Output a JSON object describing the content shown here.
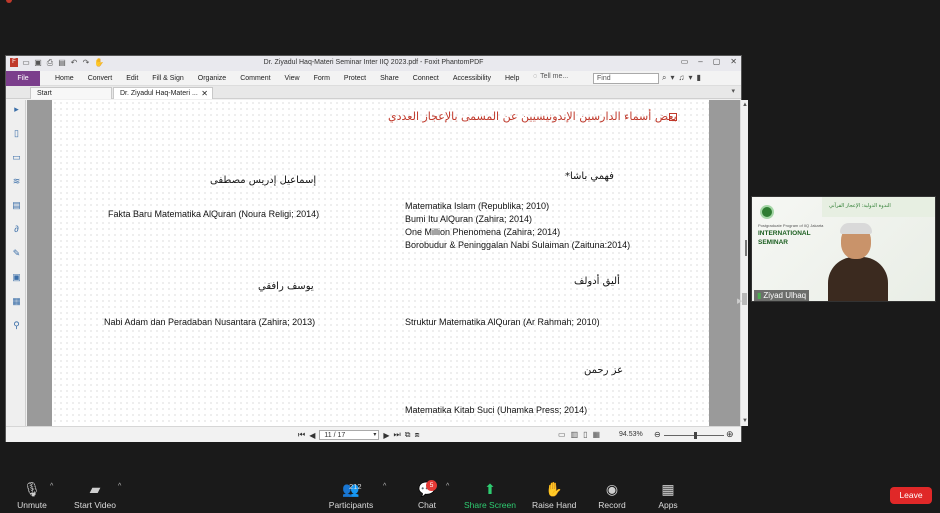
{
  "zoom_top": {
    "recording_label": ""
  },
  "foxit": {
    "window_title": "Dr. Ziyadul Haq-Materi Seminar Inter IIQ 2023.pdf - Foxit PhantomPDF",
    "menu": {
      "file": "File",
      "items": [
        "Home",
        "Convert",
        "Edit",
        "Fill & Sign",
        "Organize",
        "Comment",
        "View",
        "Form",
        "Protect",
        "Share",
        "Connect",
        "Accessibility",
        "Help"
      ],
      "tell_me": "Tell me...",
      "find_placeholder": "Find"
    },
    "tabs": [
      {
        "label": "Start"
      },
      {
        "label": "Dr. Ziyadul Haq-Materi ..."
      }
    ],
    "page": {
      "heading": "بعض أسماء الدارسين الإندونيسيين عن المسمى بالإعجاز العددي",
      "left": [
        {
          "name": "إسماعيل إدريس مصطفى",
          "works": [
            "Fakta Baru Matematika AlQuran (Noura Religi; 2014)"
          ]
        },
        {
          "name": "يوسف رافقي",
          "works": [
            "Nabi Adam dan Peradaban Nusantara (Zahira; 2013)"
          ]
        }
      ],
      "right": [
        {
          "name": "فهمي باشا*",
          "works": [
            "Matematika Islam (Republika; 2010)",
            "Bumi Itu AlQuran (Zahira; 2014)",
            "One Million Phenomena (Zahira; 2014)",
            "Borobudur & Peninggalan Nabi Sulaiman (Zaituna:2014)"
          ]
        },
        {
          "name": "أليق أدولف",
          "works": [
            "Struktur Matematika AlQuran (Ar Rahmah; 2010)"
          ]
        },
        {
          "name": "عز رحمن",
          "works": [
            "Matematika Kitab Suci (Uhamka Press; 2014)"
          ]
        }
      ]
    },
    "status": {
      "page_indicator": "11 / 17",
      "zoom": "94.53%"
    }
  },
  "video": {
    "participant_name": "Ziyad Ulhaq",
    "slide_small": "Postgraduate Program of IIQ Jakarta",
    "slide_title_1": "INTERNATIONAL",
    "slide_title_2": "SEMINAR",
    "slide_arabic": "الندوة الدولية: الإعجاز القرآني"
  },
  "zoom_toolbar": {
    "unmute": "Unmute",
    "start_video": "Start Video",
    "participants": "Participants",
    "participants_count": "212",
    "chat": "Chat",
    "chat_badge": "5",
    "share_screen": "Share Screen",
    "raise_hand": "Raise Hand",
    "record": "Record",
    "apps": "Apps",
    "leave": "Leave"
  }
}
